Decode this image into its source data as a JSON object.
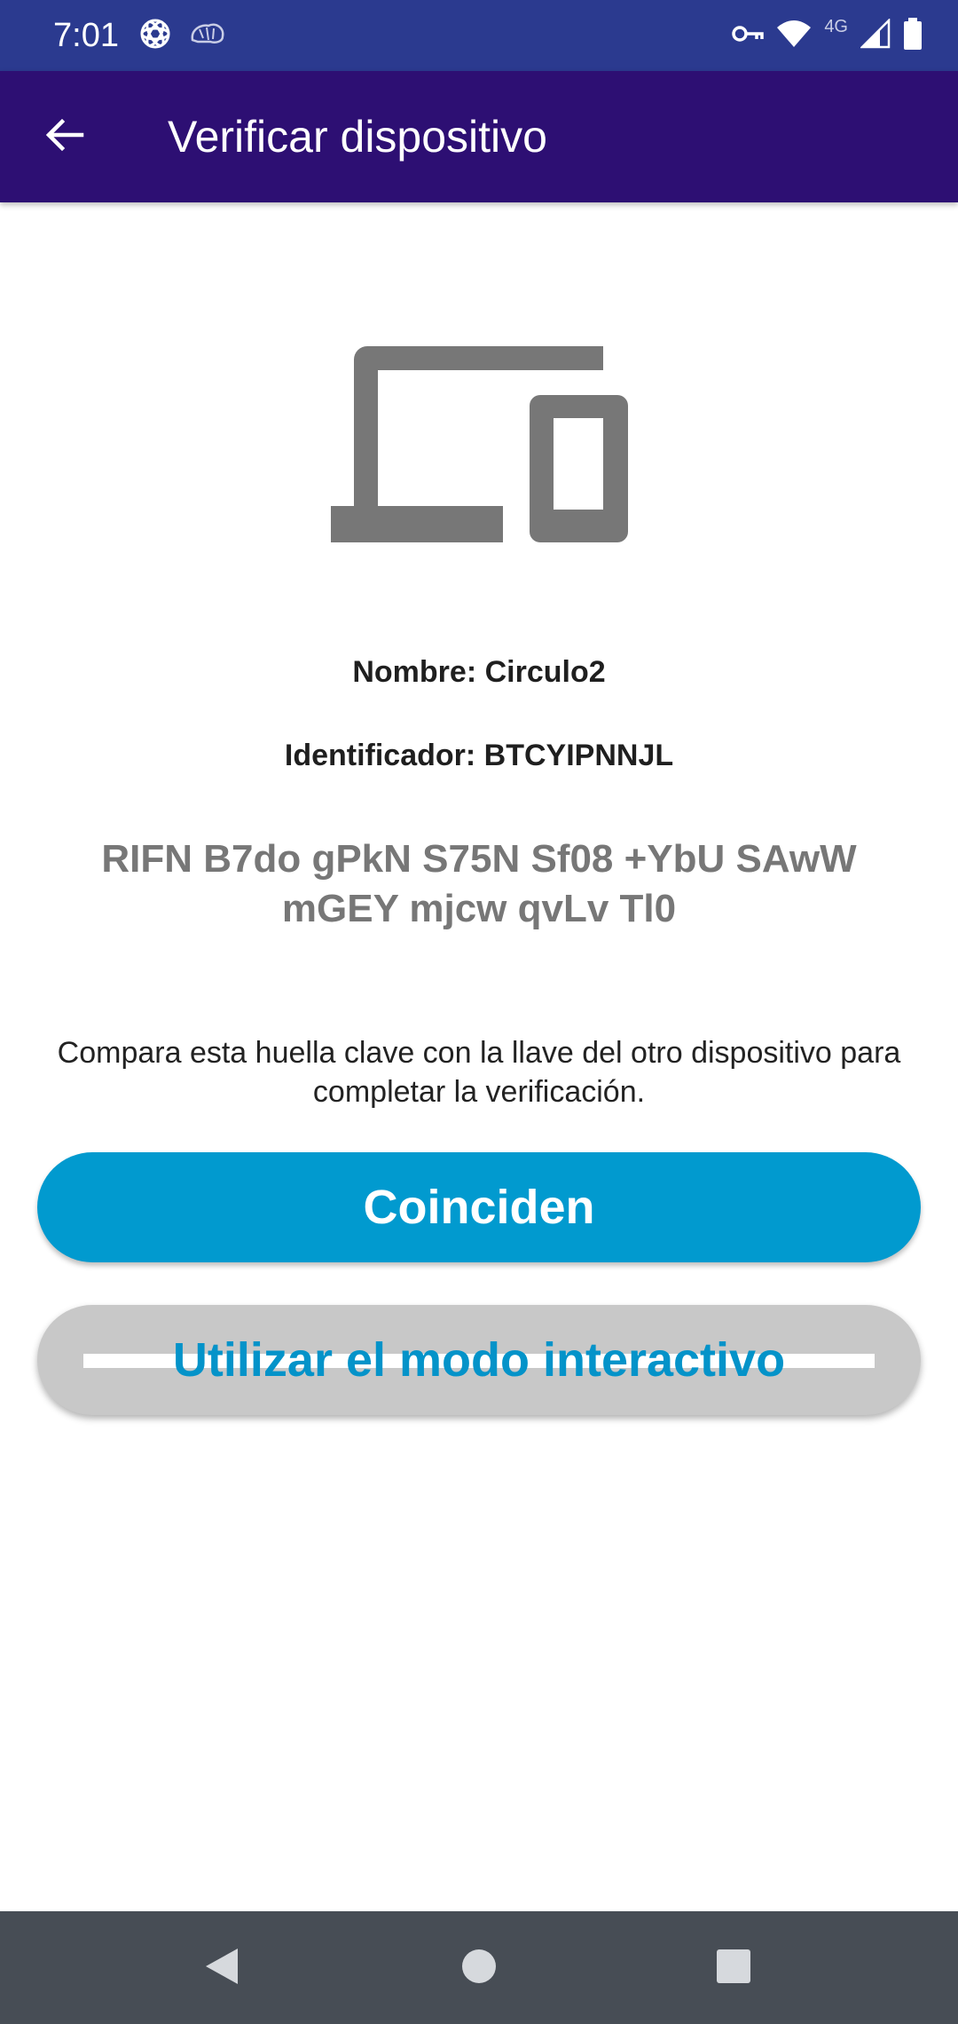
{
  "status_bar": {
    "time": "7:01",
    "network_label": "4G",
    "icons": [
      "openai-icon",
      "brain-icon",
      "vpn-key-icon",
      "wifi-icon",
      "signal-icon",
      "battery-icon"
    ]
  },
  "app_bar": {
    "title": "Verificar dispositivo",
    "back_icon": "arrow-back-icon"
  },
  "device": {
    "illustration_icon": "devices-icon",
    "name_line": "Nombre: Circulo2",
    "id_line": "Identificador: BTCYIPNNJL"
  },
  "fingerprint": {
    "line1": "RIFN B7do gPkN S75N Sf08 +YbU SAwW",
    "line2": "mGEY mjcw qvLv Tl0"
  },
  "instructions": "Compara esta huella clave con la llave del otro dispositivo para completar la verificación.",
  "buttons": {
    "match_label": "Coinciden",
    "interactive_label": "Utilizar el modo interactivo"
  },
  "nav_bar": {
    "icons": [
      "nav-back-icon",
      "nav-home-icon",
      "nav-recents-icon"
    ]
  },
  "colors": {
    "status_bar": "#2b3a8f",
    "app_bar": "#2d0f73",
    "primary_button": "#019acf",
    "secondary_button_bg": "#c8c8c8",
    "secondary_button_text": "#0493c9",
    "nav_bar": "#474d55"
  }
}
